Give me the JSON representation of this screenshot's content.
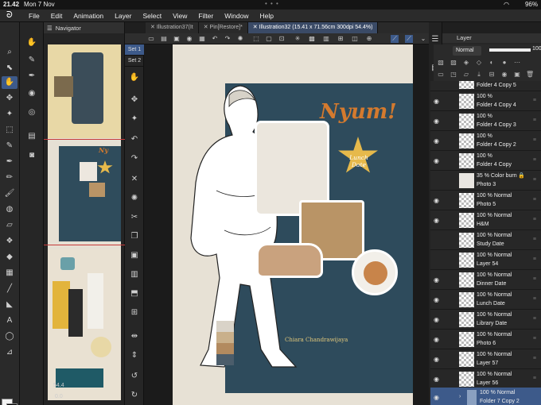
{
  "status": {
    "time": "21.42",
    "date": "Mon 7 Nov",
    "wifi_icon": "wifi-icon",
    "battery": "96%"
  },
  "menu": {
    "items": [
      "File",
      "Edit",
      "Animation",
      "Layer",
      "Select",
      "View",
      "Filter",
      "Window",
      "Help"
    ]
  },
  "tabs": [
    {
      "label": "Illustration37(It"
    },
    {
      "label": "Pin[Restore]*"
    },
    {
      "label": "Illustration32 (15.41 x 71.56cm 300dpi 54.4%)"
    }
  ],
  "navigator": {
    "title": "Navigator",
    "zoom": "54.4",
    "rotation": "0.0"
  },
  "subtool": {
    "set1": "Set 1",
    "set2": "Set 2"
  },
  "layer_panel": {
    "title": "Layer",
    "blend_mode": "Normal",
    "opacity": "100"
  },
  "canvas": {
    "headline": "Nyum!",
    "star_text_1": "Lunch",
    "star_text_2": "Date",
    "signature": "Chiara Chandrawijaya",
    "swatches": [
      "#d9d3c8",
      "#c9b08b",
      "#b28a5f",
      "#4b5d6b"
    ]
  },
  "layers": [
    {
      "opacity": "",
      "name": "Folder 4 Copy 5"
    },
    {
      "opacity": "100 %",
      "name": "Folder 4 Copy 4"
    },
    {
      "opacity": "100 %",
      "name": "Folder 4 Copy 3"
    },
    {
      "opacity": "100 %",
      "name": "Folder 4 Copy 2"
    },
    {
      "opacity": "100 %",
      "name": "Folder 4 Copy"
    },
    {
      "opacity": "35 %",
      "name": "Photo 3",
      "mode": "Color burn"
    },
    {
      "opacity": "100 %",
      "name": "Photo 5",
      "mode": "Normal"
    },
    {
      "opacity": "100 %",
      "name": "H&M",
      "mode": "Normal"
    },
    {
      "opacity": "100 %",
      "name": "Study Date",
      "mode": "Normal"
    },
    {
      "opacity": "100 %",
      "name": "Layer 54",
      "mode": "Normal"
    },
    {
      "opacity": "100 %",
      "name": "Dinner Date",
      "mode": "Normal"
    },
    {
      "opacity": "100 %",
      "name": "Lunch Date",
      "mode": "Normal"
    },
    {
      "opacity": "100 %",
      "name": "Library Date",
      "mode": "Normal"
    },
    {
      "opacity": "100 %",
      "name": "Photo 6",
      "mode": "Normal"
    },
    {
      "opacity": "100 %",
      "name": "Layer 57",
      "mode": "Normal"
    },
    {
      "opacity": "100 %",
      "name": "Layer 56",
      "mode": "Normal"
    },
    {
      "opacity": "100 %",
      "name": "Folder 7 Copy 2",
      "mode": "Normal"
    }
  ]
}
